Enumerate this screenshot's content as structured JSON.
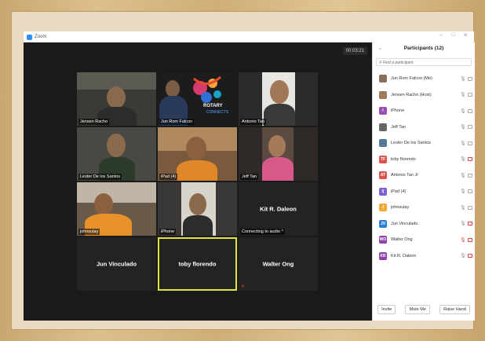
{
  "window": {
    "title": "Zoom"
  },
  "meeting": {
    "timer": "00:03:21"
  },
  "tiles": [
    {
      "name": "Jensen Racho"
    },
    {
      "name": "Jun Rom Falcon",
      "logo_text": "ROTARY",
      "logo_subtext": "CONNECTS"
    },
    {
      "name": "Antonio Tan"
    },
    {
      "name": "Lester De los Santos"
    },
    {
      "name": "iPad (4)"
    },
    {
      "name": "Jeff Tan"
    },
    {
      "name": "johnsulay"
    },
    {
      "name": "iPhone"
    },
    {
      "name": "Connecting to audio",
      "big": "Kit R. Daleon"
    },
    {
      "big": "Jun Vinculado"
    },
    {
      "big": "toby florendo"
    },
    {
      "big": "Walter Ong"
    }
  ],
  "participants_panel": {
    "title": "Participants (12)",
    "search_placeholder": "Find a participant",
    "participants": [
      {
        "name": "Jun Rom Falcon (Me)",
        "avatar": "",
        "color": "#8b6f5a",
        "muted": false,
        "cam_off": false
      },
      {
        "name": "Jensen Racho (Host)",
        "avatar": "",
        "color": "#a07a5a",
        "muted": false,
        "cam_off": false
      },
      {
        "name": "iPhone",
        "avatar": "I",
        "color": "#9b4fb3",
        "muted": false,
        "cam_off": false
      },
      {
        "name": "Jeff Tan",
        "avatar": "",
        "color": "#666666",
        "muted": false,
        "cam_off": false
      },
      {
        "name": "Lester De los Santos",
        "avatar": "",
        "color": "#557799",
        "muted": false,
        "cam_off": false
      },
      {
        "name": "toby florendo",
        "avatar": "TF",
        "color": "#d9534f",
        "muted": false,
        "cam_off": true
      },
      {
        "name": "Antonio Tan Jr",
        "avatar": "AT",
        "color": "#d9534f",
        "muted": false,
        "cam_off": false
      },
      {
        "name": "iPad (4)",
        "avatar": "I(",
        "color": "#7b5fd6",
        "muted": false,
        "cam_off": false
      },
      {
        "name": "johnsulay",
        "avatar": "J",
        "color": "#f0a830",
        "muted": false,
        "cam_off": false
      },
      {
        "name": "Jun Vinculado",
        "avatar": "JV",
        "color": "#2f7fd6",
        "muted": false,
        "cam_off": true
      },
      {
        "name": "Walter Ong",
        "avatar": "WO",
        "color": "#8e44ad",
        "muted": true,
        "cam_off": true
      },
      {
        "name": "Kit R. Daleon",
        "avatar": "KR",
        "color": "#8e44ad",
        "muted": false,
        "cam_off": true
      }
    ],
    "buttons": {
      "invite": "Invite",
      "mute_all": "Mute Me",
      "raise_hand": "Raise Hand"
    }
  }
}
